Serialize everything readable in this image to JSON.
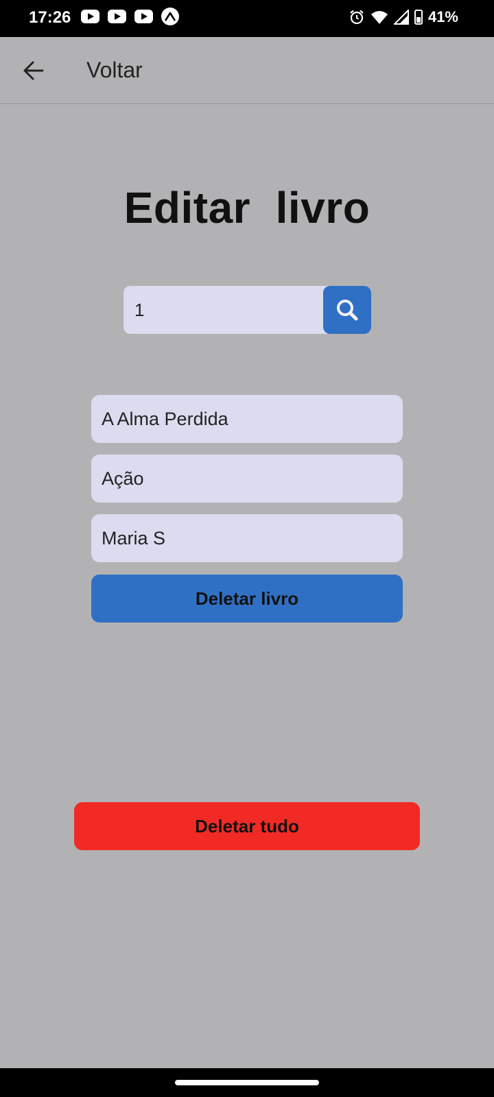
{
  "status_bar": {
    "time": "17:26",
    "notification_icons": [
      "youtube-icon",
      "youtube-icon",
      "youtube-icon",
      "expo-icon"
    ],
    "system_icons": [
      "alarm-icon",
      "wifi-icon",
      "signal-icon",
      "battery-icon"
    ],
    "battery": "41%"
  },
  "app_bar": {
    "back_icon": "arrow-left-icon",
    "back_label": "Voltar"
  },
  "main": {
    "title": "Editar  livro",
    "search": {
      "value": "1",
      "icon": "search-icon"
    },
    "fields": {
      "title_value": "A Alma Perdida",
      "genre_value": "Ação",
      "author_value": "Maria S"
    },
    "delete_book_label": "Deletar livro",
    "delete_all_label": "Deletar tudo"
  },
  "colors": {
    "background": "#b2b2b4",
    "input_fill": "#dcdcf0",
    "primary_blue": "#3070c4",
    "danger_red": "#f22a25"
  }
}
